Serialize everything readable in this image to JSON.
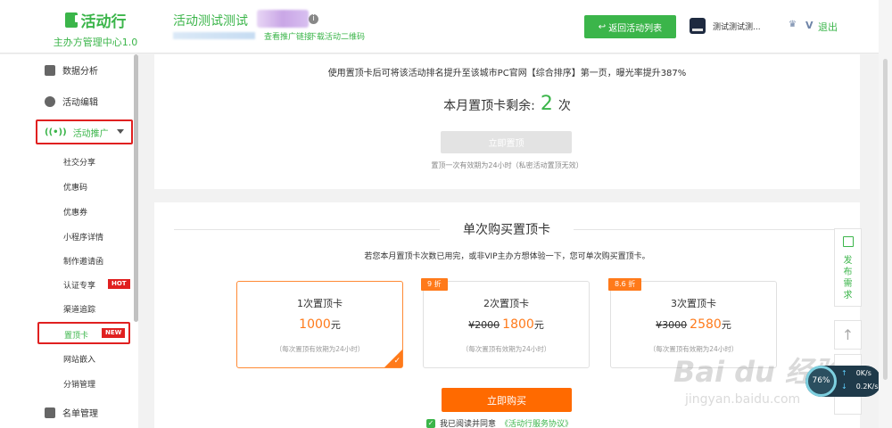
{
  "header": {
    "logo_name": "活动行",
    "logo_sub": "主办方管理中心1.0",
    "event_title": "活动测试测试",
    "link_promo": "查看推广链接",
    "link_qr": "下载活动二维码",
    "back_button": "返回活动列表",
    "user_name": "测试测试测...",
    "vip": "V",
    "logout": "退出"
  },
  "sidebar": {
    "items": [
      {
        "label": "数据分析"
      },
      {
        "label": "活动编辑"
      },
      {
        "label": "活动推广"
      }
    ],
    "subitems": [
      "社交分享",
      "优惠码",
      "优惠券",
      "小程序详情",
      "制作邀请函",
      "认证专享",
      "置顶卡",
      "渠道追踪",
      "网站嵌入",
      "分销管理"
    ],
    "hot_tag": "HOT",
    "new_tag": "NEW",
    "bottom_item": "名单管理"
  },
  "top_card": {
    "notice": "使用置顶卡后可将该活动排名提升至该城市PC官网【综合排序】第一页，曝光率提升387%",
    "remain_label": "本月置顶卡剩余:",
    "remain_count": "2",
    "remain_unit": "次",
    "button": "立即置顶",
    "note": "置顶一次有效期为24小时（私密活动置顶无效）"
  },
  "buy_card": {
    "title": "单次购买置顶卡",
    "desc": "若您本月置顶卡次数已用完，或非VIP主办方想体验一下，您可单次购买置顶卡。",
    "packages": [
      {
        "name": "1次置顶卡",
        "orig": "",
        "price": "1000",
        "unit": "元",
        "note": "（每次置顶有效期为24小时）",
        "tag": "",
        "selected": true
      },
      {
        "name": "2次置顶卡",
        "orig": "¥2000",
        "price": "1800",
        "unit": "元",
        "note": "（每次置顶有效期为24小时）",
        "tag": "9 折",
        "selected": false
      },
      {
        "name": "3次置顶卡",
        "orig": "¥3000",
        "price": "2580",
        "unit": "元",
        "note": "（每次置顶有效期为24小时）",
        "tag": "8.6 折",
        "selected": false
      }
    ],
    "buy_button": "立即购买",
    "agree_text": "我已阅读并同意",
    "agree_link": "《活动行服务协议》"
  },
  "float": {
    "publish": "发\n布\n需\n求",
    "top_arrow": "↑"
  },
  "network": {
    "percent": "76%",
    "up": "0K/s",
    "down": "0.2K/s"
  },
  "watermark": {
    "main": "Bai du 经验",
    "sub": "jingyan.baidu.com"
  },
  "colors": {
    "brand_green": "#3bb54a",
    "accent_orange": "#ff6a00",
    "highlight_red": "#e02020"
  }
}
